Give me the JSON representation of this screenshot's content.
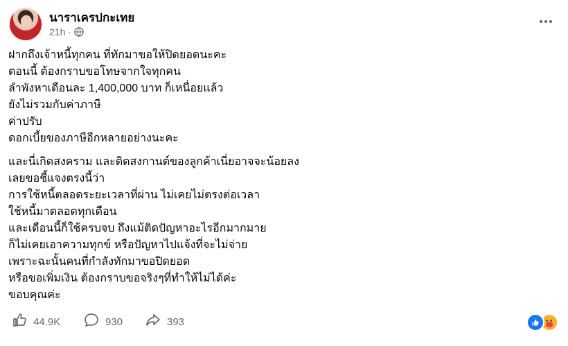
{
  "post": {
    "author": "นาราเครปกะเทย",
    "timestamp": "21h",
    "separator": "·",
    "audience_icon": "globe-icon",
    "lines_block1": [
      "ฝากถึงเจ้าหนี้ทุกคน ที่ทักมาขอให้ปิดยอดนะคะ",
      "ตอนนี้ ต้องกราบขอโทษจากใจทุกคน",
      "ลำพังหาเดือนละ 1,400,000 บาท ก็เหนื่อยแล้ว",
      "ยังไม่รวมกับค่าภาษี",
      "ค่าปรับ",
      "ดอกเบี้ยของภาษีอีกหลายอย่างนะคะ"
    ],
    "lines_block2": [
      "และนี่เกิดสงคราม และติดสงกานต์ของลูกค้าเนี่ยอาจจะน้อยลง",
      "เลยขอชี้แจงตรงนี้ว่า",
      "การใช้หนี้ตลอดระยะเวลาที่ผ่าน ไม่เคยไม่ตรงต่อเวลา",
      "ใช้หนี้มาตลอดทุกเดือน",
      "และเดือนนี้ก็ใช้ครบจบ ถึงแม้ติดปัญหาอะไรอีกมากมาย",
      "ก็ไม่เคยเอาความทุกข์ หรือปัญหาไปแจ้งที่จะไม่จ่าย",
      "เพราะฉะนั้นคนที่กำลังทักมาขอปิดยอด",
      "หรือขอเพิ่มเงิน ต้องกราบขอจริงๆที่ทำให้ไม่ได้ค่ะ",
      "ขอบคุณค่ะ"
    ]
  },
  "footer": {
    "likes": "44.9K",
    "comments": "930",
    "shares": "393"
  },
  "colors": {
    "text": "#050505",
    "secondary": "#65676b",
    "like_blue": "#1877f2"
  }
}
